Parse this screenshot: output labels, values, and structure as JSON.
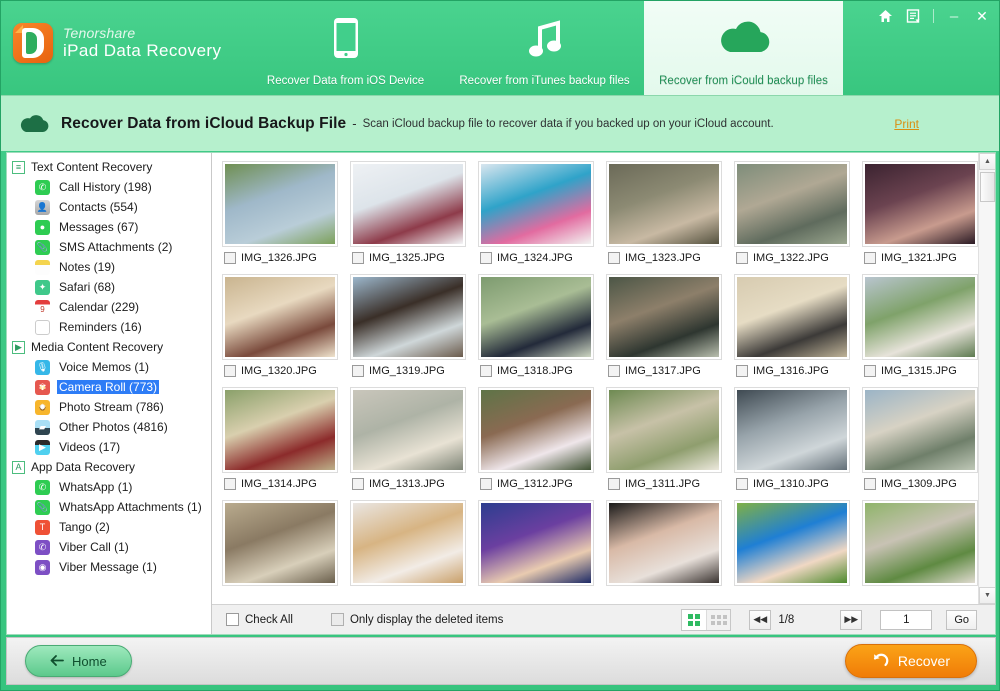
{
  "app": {
    "brand_top": "Tenorshare",
    "brand_bottom": "iPad Data Recovery",
    "logo_icon": "tenorshare-d-logo-icon"
  },
  "window_controls": {
    "home_icon": "home-icon",
    "feedback_icon": "feedback-note-icon",
    "minimize_label": "–",
    "close_label": "✕"
  },
  "tabs": [
    {
      "label": "Recover Data from iOS Device",
      "icon": "iphone-icon",
      "active": false
    },
    {
      "label": "Recover from iTunes backup files",
      "icon": "music-note-icon",
      "active": false
    },
    {
      "label": "Recover from iCould backup files",
      "icon": "cloud-icon",
      "active": true
    }
  ],
  "subheader": {
    "icon": "cloud-icon",
    "title": "Recover Data from iCloud Backup File",
    "dash": "-",
    "description": "Scan iCloud backup file to recover data if you backed up on your iCloud account.",
    "print_label": "Print"
  },
  "sidebar": {
    "groups": [
      {
        "label": "Text Content Recovery",
        "marker": "list-icon",
        "marker_glyph": "≡",
        "items": [
          {
            "label": "Call History (198)",
            "icon": "phone-icon",
            "color": "#2ecc52",
            "glyph": "✆",
            "selected": false
          },
          {
            "label": "Contacts (554)",
            "icon": "contacts-icon",
            "color": "#a8a8a8",
            "glyph": "👤",
            "selected": false
          },
          {
            "label": "Messages (67)",
            "icon": "messages-icon",
            "color": "#2ecc52",
            "glyph": "●",
            "selected": false
          },
          {
            "label": "SMS Attachments (2)",
            "icon": "paperclip-icon",
            "color": "#2ecc52",
            "glyph": "📎",
            "selected": false
          },
          {
            "label": "Notes (19)",
            "icon": "notes-icon",
            "color": "#f6d352",
            "glyph": "",
            "selected": false
          },
          {
            "label": "Safari (68)",
            "icon": "safari-compass-icon",
            "color": "#3fc88a",
            "glyph": "✦",
            "selected": false
          },
          {
            "label": "Calendar (229)",
            "icon": "calendar-icon",
            "color": "#ffffff",
            "glyph": "9",
            "selected": false
          },
          {
            "label": "Reminders (16)",
            "icon": "reminders-icon",
            "color": "#ffffff",
            "glyph": "",
            "selected": false
          }
        ]
      },
      {
        "label": "Media Content Recovery",
        "marker": "play-triangle-icon",
        "marker_glyph": "▶",
        "items": [
          {
            "label": "Voice Memos (1)",
            "icon": "microphone-icon",
            "color": "#35b7e8",
            "glyph": "🎙",
            "selected": false
          },
          {
            "label": "Camera Roll (773)",
            "icon": "photos-flower-icon",
            "color": "#e6584f",
            "glyph": "✾",
            "selected": true
          },
          {
            "label": "Photo Stream (786)",
            "icon": "sunflower-icon",
            "color": "#f7b52c",
            "glyph": "✹",
            "selected": false
          },
          {
            "label": "Other Photos (4816)",
            "icon": "landscape-photo-icon",
            "color": "#6cc6ef",
            "glyph": "▰",
            "selected": false
          },
          {
            "label": "Videos (17)",
            "icon": "video-clapper-icon",
            "color": "#4fd0ef",
            "glyph": "▶",
            "selected": false
          }
        ]
      },
      {
        "label": "App Data Recovery",
        "marker": "app-icon",
        "marker_glyph": "A",
        "items": [
          {
            "label": "WhatsApp (1)",
            "icon": "whatsapp-icon",
            "color": "#2ecc52",
            "glyph": "✆",
            "selected": false
          },
          {
            "label": "WhatsApp Attachments (1)",
            "icon": "whatsapp-paperclip-icon",
            "color": "#2ecc52",
            "glyph": "📎",
            "selected": false
          },
          {
            "label": "Tango (2)",
            "icon": "tango-icon",
            "color": "#ef5136",
            "glyph": "T",
            "selected": false
          },
          {
            "label": "Viber Call (1)",
            "icon": "viber-call-icon",
            "color": "#7d4fc4",
            "glyph": "✆",
            "selected": false
          },
          {
            "label": "Viber Message (1)",
            "icon": "viber-message-icon",
            "color": "#7d4fc4",
            "glyph": "◉",
            "selected": false
          }
        ]
      }
    ]
  },
  "gallery": {
    "items": [
      {
        "filename": "IMG_1326.JPG",
        "checked": false,
        "scene": "kids-jumping-into-lake"
      },
      {
        "filename": "IMG_1325.JPG",
        "checked": false,
        "scene": "girl-playing-violin-bedroom"
      },
      {
        "filename": "IMG_1324.JPG",
        "checked": false,
        "scene": "children-around-laptop"
      },
      {
        "filename": "IMG_1323.JPG",
        "checked": false,
        "scene": "woman-standing-in-field"
      },
      {
        "filename": "IMG_1322.JPG",
        "checked": false,
        "scene": "people-walking-on-bridge"
      },
      {
        "filename": "IMG_1321.JPG",
        "checked": false,
        "scene": "woman-at-table-dark"
      },
      {
        "filename": "IMG_1320.JPG",
        "checked": false,
        "scene": "smiling-woman-floral-dress"
      },
      {
        "filename": "IMG_1319.JPG",
        "checked": false,
        "scene": "girl-with-horse-on-beach"
      },
      {
        "filename": "IMG_1318.JPG",
        "checked": false,
        "scene": "woman-in-tracksuit-outdoors"
      },
      {
        "filename": "IMG_1317.JPG",
        "checked": false,
        "scene": "group-of-people-street"
      },
      {
        "filename": "IMG_1316.JPG",
        "checked": false,
        "scene": "woman-walking-by-building"
      },
      {
        "filename": "IMG_1315.JPG",
        "checked": false,
        "scene": "friends-walking-park"
      },
      {
        "filename": "IMG_1314.JPG",
        "checked": false,
        "scene": "woman-reading-on-beach"
      },
      {
        "filename": "IMG_1313.JPG",
        "checked": false,
        "scene": "couple-kissing-at-monument"
      },
      {
        "filename": "IMG_1312.JPG",
        "checked": false,
        "scene": "women-with-cotton-candy"
      },
      {
        "filename": "IMG_1311.JPG",
        "checked": false,
        "scene": "woman-walking-park-path"
      },
      {
        "filename": "IMG_1310.JPG",
        "checked": false,
        "scene": "woman-on-bench-with-bike"
      },
      {
        "filename": "IMG_1309.JPG",
        "checked": false,
        "scene": "woman-sitting-on-road"
      },
      {
        "filename": "",
        "checked": false,
        "scene": "woman-hugging-outdoors"
      },
      {
        "filename": "",
        "checked": false,
        "scene": "family-with-golden-retriever"
      },
      {
        "filename": "",
        "checked": false,
        "scene": "girl-in-purple-shirt"
      },
      {
        "filename": "",
        "checked": false,
        "scene": "woman-at-desk-dark"
      },
      {
        "filename": "",
        "checked": false,
        "scene": "girl-with-blue-helmet"
      },
      {
        "filename": "",
        "checked": false,
        "scene": "two-people-jogging-road"
      }
    ]
  },
  "toolbar": {
    "check_all_label": "Check All",
    "check_all_checked": false,
    "only_deleted_label": "Only display the deleted items",
    "only_deleted_checked": false,
    "view_grid_icon": "grid-large-icon",
    "view_list_icon": "grid-small-icon",
    "prev_icon": "first-page-icon",
    "next_icon": "last-page-icon",
    "page_text": "1/8",
    "page_input_value": "1",
    "go_label": "Go"
  },
  "footer": {
    "home_label": "Home",
    "home_icon": "arrow-left-icon",
    "recover_label": "Recover",
    "recover_icon": "undo-arrow-icon"
  },
  "colors": {
    "brand_green": "#43cd8b",
    "subheader_green": "#b6f0cd",
    "accent_orange": "#f59210",
    "selection_blue": "#2d7cf6",
    "print_link": "#d98f12"
  }
}
